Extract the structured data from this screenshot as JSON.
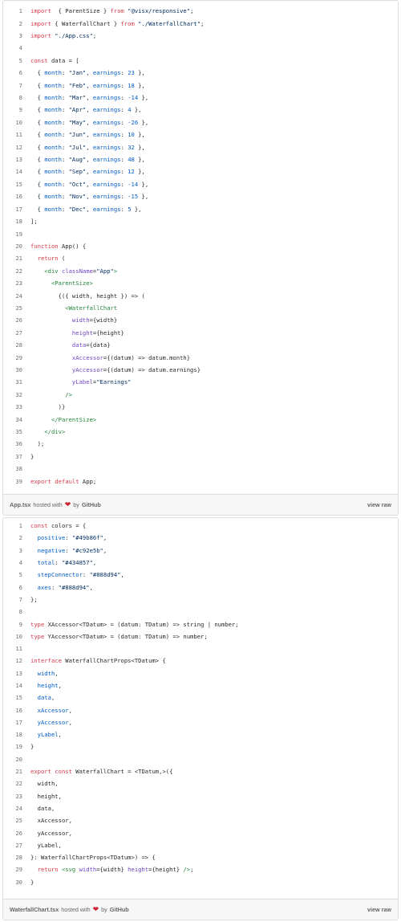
{
  "gists": [
    {
      "filename": "App.tsx",
      "hosted_with": "hosted with",
      "by": "by",
      "github": "GitHub",
      "view_raw": "view raw",
      "lines": [
        [
          [
            "kw",
            "import"
          ],
          [
            "",
            "  { ParentSize } "
          ],
          [
            "kw",
            "from"
          ],
          [
            "st",
            " \"@visx/responsive\""
          ],
          [
            "",
            ";"
          ]
        ],
        [
          [
            "kw",
            "import"
          ],
          [
            "",
            " { WaterfallChart } "
          ],
          [
            "kw",
            "from"
          ],
          [
            "st",
            " \"./WaterfallChart\""
          ],
          [
            "",
            ";"
          ]
        ],
        [
          [
            "kw",
            "import"
          ],
          [
            "st",
            " \"./App.css\""
          ],
          [
            "",
            ";"
          ]
        ],
        [
          [
            "",
            ""
          ]
        ],
        [
          [
            "kw",
            "const"
          ],
          [
            "",
            " data = ["
          ]
        ],
        [
          [
            "",
            "  { "
          ],
          [
            "pr",
            "month"
          ],
          [
            "",
            ": "
          ],
          [
            "st",
            "\"Jan\""
          ],
          [
            "",
            ", "
          ],
          [
            "pr",
            "earnings"
          ],
          [
            "",
            ": "
          ],
          [
            "nu",
            "23"
          ],
          [
            "",
            " },"
          ]
        ],
        [
          [
            "",
            "  { "
          ],
          [
            "pr",
            "month"
          ],
          [
            "",
            ": "
          ],
          [
            "st",
            "\"Feb\""
          ],
          [
            "",
            ", "
          ],
          [
            "pr",
            "earnings"
          ],
          [
            "",
            ": "
          ],
          [
            "nu",
            "18"
          ],
          [
            "",
            " },"
          ]
        ],
        [
          [
            "",
            "  { "
          ],
          [
            "pr",
            "month"
          ],
          [
            "",
            ": "
          ],
          [
            "st",
            "\"Mar\""
          ],
          [
            "",
            ", "
          ],
          [
            "pr",
            "earnings"
          ],
          [
            "",
            ": "
          ],
          [
            "nu",
            "-14"
          ],
          [
            "",
            " },"
          ]
        ],
        [
          [
            "",
            "  { "
          ],
          [
            "pr",
            "month"
          ],
          [
            "",
            ": "
          ],
          [
            "st",
            "\"Apr\""
          ],
          [
            "",
            ", "
          ],
          [
            "pr",
            "earnings"
          ],
          [
            "",
            ": "
          ],
          [
            "nu",
            "4"
          ],
          [
            "",
            " },"
          ]
        ],
        [
          [
            "",
            "  { "
          ],
          [
            "pr",
            "month"
          ],
          [
            "",
            ": "
          ],
          [
            "st",
            "\"May\""
          ],
          [
            "",
            ", "
          ],
          [
            "pr",
            "earnings"
          ],
          [
            "",
            ": "
          ],
          [
            "nu",
            "-26"
          ],
          [
            "",
            " },"
          ]
        ],
        [
          [
            "",
            "  { "
          ],
          [
            "pr",
            "month"
          ],
          [
            "",
            ": "
          ],
          [
            "st",
            "\"Jun\""
          ],
          [
            "",
            ", "
          ],
          [
            "pr",
            "earnings"
          ],
          [
            "",
            ": "
          ],
          [
            "nu",
            "10"
          ],
          [
            "",
            " },"
          ]
        ],
        [
          [
            "",
            "  { "
          ],
          [
            "pr",
            "month"
          ],
          [
            "",
            ": "
          ],
          [
            "st",
            "\"Jul\""
          ],
          [
            "",
            ", "
          ],
          [
            "pr",
            "earnings"
          ],
          [
            "",
            ": "
          ],
          [
            "nu",
            "32"
          ],
          [
            "",
            " },"
          ]
        ],
        [
          [
            "",
            "  { "
          ],
          [
            "pr",
            "month"
          ],
          [
            "",
            ": "
          ],
          [
            "st",
            "\"Aug\""
          ],
          [
            "",
            ", "
          ],
          [
            "pr",
            "earnings"
          ],
          [
            "",
            ": "
          ],
          [
            "nu",
            "48"
          ],
          [
            "",
            " },"
          ]
        ],
        [
          [
            "",
            "  { "
          ],
          [
            "pr",
            "month"
          ],
          [
            "",
            ": "
          ],
          [
            "st",
            "\"Sep\""
          ],
          [
            "",
            ", "
          ],
          [
            "pr",
            "earnings"
          ],
          [
            "",
            ": "
          ],
          [
            "nu",
            "12"
          ],
          [
            "",
            " },"
          ]
        ],
        [
          [
            "",
            "  { "
          ],
          [
            "pr",
            "month"
          ],
          [
            "",
            ": "
          ],
          [
            "st",
            "\"Oct\""
          ],
          [
            "",
            ", "
          ],
          [
            "pr",
            "earnings"
          ],
          [
            "",
            ": "
          ],
          [
            "nu",
            "-14"
          ],
          [
            "",
            " },"
          ]
        ],
        [
          [
            "",
            "  { "
          ],
          [
            "pr",
            "month"
          ],
          [
            "",
            ": "
          ],
          [
            "st",
            "\"Nov\""
          ],
          [
            "",
            ", "
          ],
          [
            "pr",
            "earnings"
          ],
          [
            "",
            ": "
          ],
          [
            "nu",
            "-15"
          ],
          [
            "",
            " },"
          ]
        ],
        [
          [
            "",
            "  { "
          ],
          [
            "pr",
            "month"
          ],
          [
            "",
            ": "
          ],
          [
            "st",
            "\"Dec\""
          ],
          [
            "",
            ", "
          ],
          [
            "pr",
            "earnings"
          ],
          [
            "",
            ": "
          ],
          [
            "nu",
            "5"
          ],
          [
            "",
            " },"
          ]
        ],
        [
          [
            "",
            "];"
          ]
        ],
        [
          [
            "",
            ""
          ]
        ],
        [
          [
            "kw",
            "function"
          ],
          [
            "",
            " App() {"
          ]
        ],
        [
          [
            "kw",
            "  return"
          ],
          [
            "",
            " ("
          ]
        ],
        [
          [
            "tg",
            "    <div"
          ],
          [
            "at",
            " className"
          ],
          [
            "",
            "="
          ],
          [
            "st",
            "\"App\""
          ],
          [
            "tg",
            ">"
          ]
        ],
        [
          [
            "tg",
            "      <ParentSize>"
          ]
        ],
        [
          [
            "",
            "        {({ width, height }) => ("
          ]
        ],
        [
          [
            "tg",
            "          <WaterfallChart"
          ]
        ],
        [
          [
            "at",
            "            width"
          ],
          [
            "",
            "={width}"
          ]
        ],
        [
          [
            "at",
            "            height"
          ],
          [
            "",
            "={height}"
          ]
        ],
        [
          [
            "at",
            "            data"
          ],
          [
            "",
            "={data}"
          ]
        ],
        [
          [
            "at",
            "            xAccessor"
          ],
          [
            "",
            "={(datum) => datum.month}"
          ]
        ],
        [
          [
            "at",
            "            yAccessor"
          ],
          [
            "",
            "={(datum) => datum.earnings}"
          ]
        ],
        [
          [
            "at",
            "            yLabel"
          ],
          [
            "",
            "="
          ],
          [
            "st",
            "\"Earnings\""
          ]
        ],
        [
          [
            "tg",
            "          />"
          ]
        ],
        [
          [
            "",
            "        )}"
          ]
        ],
        [
          [
            "tg",
            "      </ParentSize>"
          ]
        ],
        [
          [
            "tg",
            "    </div>"
          ]
        ],
        [
          [
            "",
            "  );"
          ]
        ],
        [
          [
            "",
            "}"
          ]
        ],
        [
          [
            "",
            ""
          ]
        ],
        [
          [
            "kw",
            "export default"
          ],
          [
            "",
            " App;"
          ]
        ]
      ]
    },
    {
      "filename": "WaterfallChart.tsx",
      "hosted_with": "hosted with",
      "by": "by",
      "github": "GitHub",
      "view_raw": "view raw",
      "lines": [
        [
          [
            "kw",
            "const"
          ],
          [
            "",
            " colors = {"
          ]
        ],
        [
          [
            "pr",
            "  positive"
          ],
          [
            "",
            ": "
          ],
          [
            "st",
            "\"#49b86f\""
          ],
          [
            "",
            ","
          ]
        ],
        [
          [
            "pr",
            "  negative"
          ],
          [
            "",
            ": "
          ],
          [
            "st",
            "\"#c92e5b\""
          ],
          [
            "",
            ","
          ]
        ],
        [
          [
            "pr",
            "  total"
          ],
          [
            "",
            ": "
          ],
          [
            "st",
            "\"#434857\""
          ],
          [
            "",
            ","
          ]
        ],
        [
          [
            "pr",
            "  stepConnector"
          ],
          [
            "",
            ": "
          ],
          [
            "st",
            "\"#888d94\""
          ],
          [
            "",
            ","
          ]
        ],
        [
          [
            "pr",
            "  axes"
          ],
          [
            "",
            ": "
          ],
          [
            "st",
            "\"#888d94\""
          ],
          [
            "",
            ","
          ]
        ],
        [
          [
            "",
            "};"
          ]
        ],
        [
          [
            "",
            ""
          ]
        ],
        [
          [
            "kw",
            "type"
          ],
          [
            "",
            " XAccessor<TDatum> = (datum: TDatum) => string | number;"
          ]
        ],
        [
          [
            "kw",
            "type"
          ],
          [
            "",
            " YAccessor<TDatum> = (datum: TDatum) => number;"
          ]
        ],
        [
          [
            "",
            ""
          ]
        ],
        [
          [
            "kw",
            "interface"
          ],
          [
            "",
            " WaterfallChartProps<TDatum> {"
          ]
        ],
        [
          [
            "pr",
            "  width"
          ],
          [
            "",
            ","
          ]
        ],
        [
          [
            "pr",
            "  height"
          ],
          [
            "",
            ","
          ]
        ],
        [
          [
            "pr",
            "  data"
          ],
          [
            "",
            ","
          ]
        ],
        [
          [
            "pr",
            "  xAccessor"
          ],
          [
            "",
            ","
          ]
        ],
        [
          [
            "pr",
            "  yAccessor"
          ],
          [
            "",
            ","
          ]
        ],
        [
          [
            "pr",
            "  yLabel"
          ],
          [
            "",
            ","
          ]
        ],
        [
          [
            "",
            "}"
          ]
        ],
        [
          [
            "",
            ""
          ]
        ],
        [
          [
            "kw",
            "export const"
          ],
          [
            "",
            " WaterfallChart = <TDatum,>({"
          ]
        ],
        [
          [
            "",
            "  width,"
          ]
        ],
        [
          [
            "",
            "  height,"
          ]
        ],
        [
          [
            "",
            "  data,"
          ]
        ],
        [
          [
            "",
            "  xAccessor,"
          ]
        ],
        [
          [
            "",
            "  yAccessor,"
          ]
        ],
        [
          [
            "",
            "  yLabel,"
          ]
        ],
        [
          [
            "",
            "}: WaterfallChartProps<TDatum>) => {"
          ]
        ],
        [
          [
            "kw",
            "  return"
          ],
          [
            "tg",
            " <svg"
          ],
          [
            "at",
            " width"
          ],
          [
            "",
            "={width}"
          ],
          [
            "at",
            " height"
          ],
          [
            "",
            "={height} "
          ],
          [
            "tg",
            "/>"
          ],
          [
            "",
            ";"
          ]
        ],
        [
          [
            "",
            "}"
          ]
        ]
      ]
    }
  ]
}
